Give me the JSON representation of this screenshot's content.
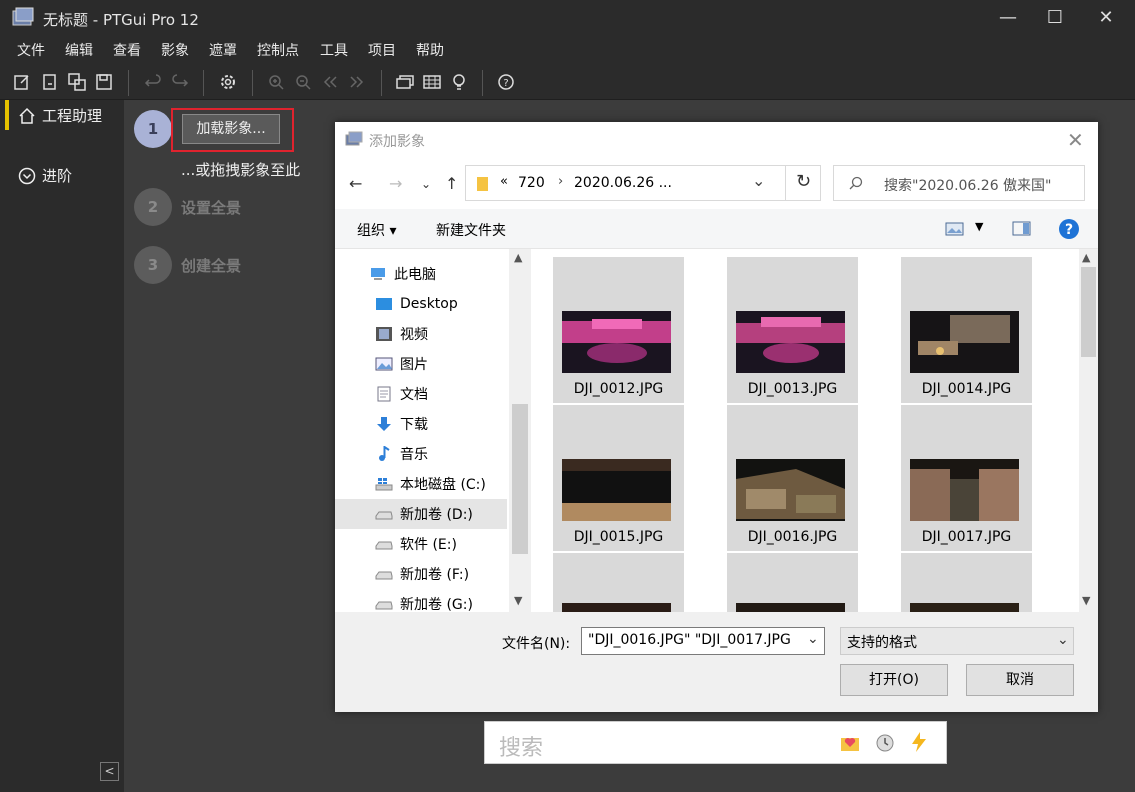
{
  "window": {
    "title": "无标题 - PTGui Pro 12"
  },
  "menu": [
    "文件",
    "编辑",
    "查看",
    "影象",
    "遮罩",
    "控制点",
    "工具",
    "项目",
    "帮助"
  ],
  "sidebar": {
    "items": [
      "工程助理",
      "进阶"
    ]
  },
  "steps": [
    {
      "num": "1",
      "button": "加载影象...",
      "hint": "...或拖拽影象至此"
    },
    {
      "num": "2",
      "label": "设置全景"
    },
    {
      "num": "3",
      "label": "创建全景"
    }
  ],
  "dialog": {
    "title": "添加影象",
    "path": {
      "prefix": "«",
      "seg1": "720",
      "seg2": "2020.06.26 ..."
    },
    "search_placeholder": "搜索\"2020.06.26 傲来国\"",
    "organize": "组织",
    "new_folder": "新建文件夹",
    "tree": [
      "此电脑",
      "Desktop",
      "视频",
      "图片",
      "文档",
      "下载",
      "音乐",
      "本地磁盘 (C:)",
      "新加卷 (D:)",
      "软件 (E:)",
      "新加卷 (F:)",
      "新加卷 (G:)"
    ],
    "files": [
      "DJI_0012.JPG",
      "DJI_0013.JPG",
      "DJI_0014.JPG",
      "DJI_0015.JPG",
      "DJI_0016.JPG",
      "DJI_0017.JPG"
    ],
    "filename_label": "文件名(N):",
    "filename_value": "\"DJI_0016.JPG\" \"DJI_0017.JPG",
    "filter": "支持的格式",
    "open": "打开(O)",
    "cancel": "取消"
  },
  "search_strip": {
    "placeholder": "搜索"
  },
  "colors": {
    "accent": "#e6c200",
    "highlight": "#e0232e",
    "step_active": "#a9b2d6"
  }
}
